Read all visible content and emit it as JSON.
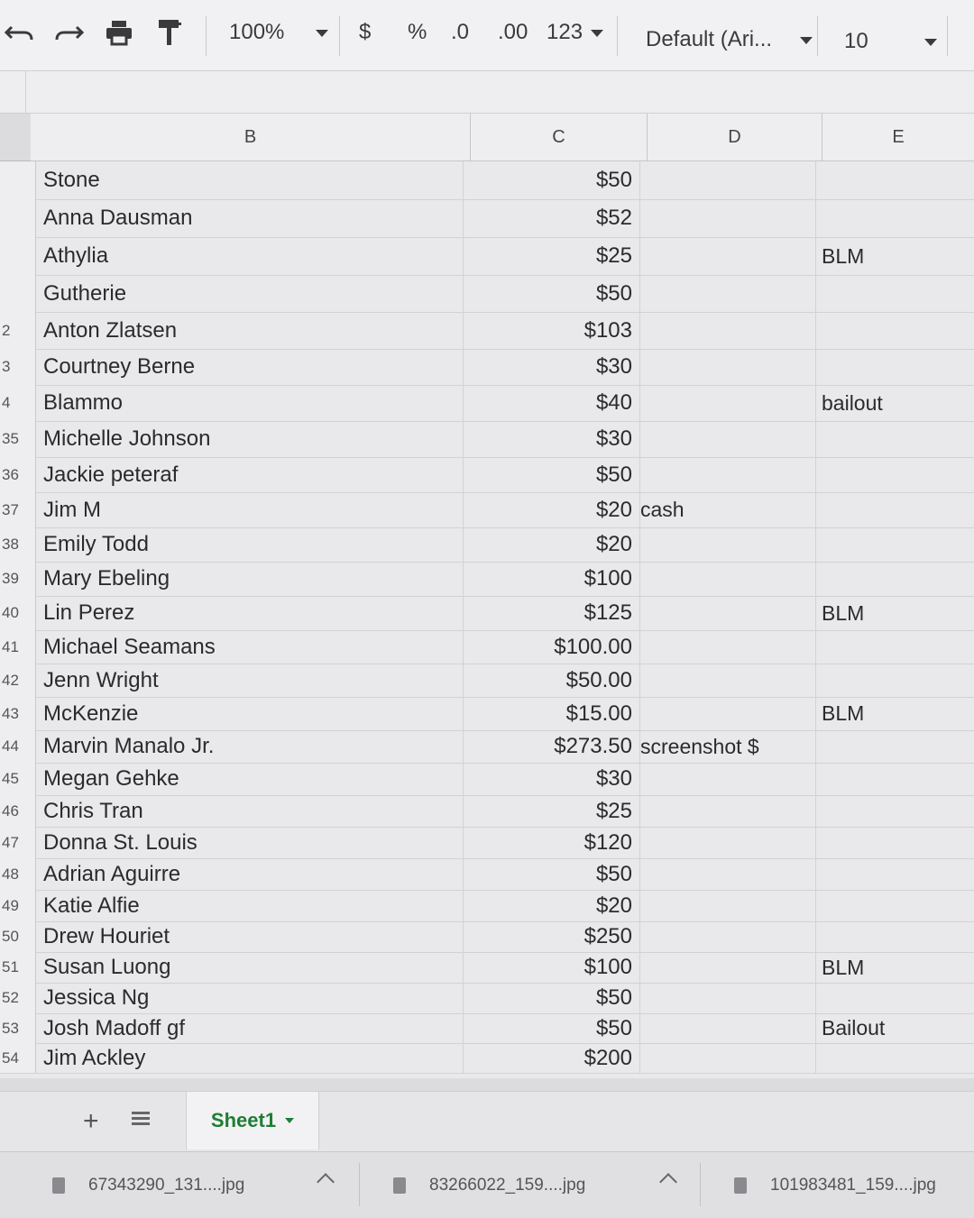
{
  "toolbar": {
    "zoom": "100%",
    "currency": "$",
    "percent": "%",
    "decrease_decimal": ".0",
    "increase_decimal": ".00",
    "more_formats": "123",
    "font": "Default (Ari...",
    "font_size": "10"
  },
  "columns": [
    "B",
    "C",
    "D",
    "E"
  ],
  "rows": [
    {
      "num": "",
      "name": "Stone",
      "amount": "$50",
      "note_d": "",
      "note_e": ""
    },
    {
      "num": "",
      "name": "Anna Dausman",
      "amount": "$52",
      "note_d": "",
      "note_e": ""
    },
    {
      "num": "",
      "name": "Athylia",
      "amount": "$25",
      "note_d": "",
      "note_e": "BLM"
    },
    {
      "num": "",
      "name": "Gutherie",
      "amount": "$50",
      "note_d": "",
      "note_e": ""
    },
    {
      "num": "2",
      "name": "Anton Zlatsen",
      "amount": "$103",
      "note_d": "",
      "note_e": ""
    },
    {
      "num": "3",
      "name": "Courtney Berne",
      "amount": "$30",
      "note_d": "",
      "note_e": ""
    },
    {
      "num": "4",
      "name": "Blammo",
      "amount": "$40",
      "note_d": "",
      "note_e": "bailout"
    },
    {
      "num": "35",
      "name": "Michelle Johnson",
      "amount": "$30",
      "note_d": "",
      "note_e": ""
    },
    {
      "num": "36",
      "name": "Jackie peteraf",
      "amount": "$50",
      "note_d": "",
      "note_e": ""
    },
    {
      "num": "37",
      "name": "Jim M",
      "amount": "$20",
      "note_d": "cash",
      "note_e": ""
    },
    {
      "num": "38",
      "name": "Emily Todd",
      "amount": "$20",
      "note_d": "",
      "note_e": ""
    },
    {
      "num": "39",
      "name": "Mary Ebeling",
      "amount": "$100",
      "note_d": "",
      "note_e": ""
    },
    {
      "num": "40",
      "name": "Lin Perez",
      "amount": "$125",
      "note_d": "",
      "note_e": "BLM"
    },
    {
      "num": "41",
      "name": "Michael Seamans",
      "amount": "$100.00",
      "note_d": "",
      "note_e": ""
    },
    {
      "num": "42",
      "name": "Jenn Wright",
      "amount": "$50.00",
      "note_d": "",
      "note_e": ""
    },
    {
      "num": "43",
      "name": "McKenzie",
      "amount": "$15.00",
      "note_d": "",
      "note_e": "BLM"
    },
    {
      "num": "44",
      "name": "Marvin Manalo Jr.",
      "amount": "$273.50",
      "note_d": "screenshot $",
      "note_e": ""
    },
    {
      "num": "45",
      "name": "Megan Gehke",
      "amount": "$30",
      "note_d": "",
      "note_e": ""
    },
    {
      "num": "46",
      "name": "Chris Tran",
      "amount": "$25",
      "note_d": "",
      "note_e": ""
    },
    {
      "num": "47",
      "name": "Donna St. Louis",
      "amount": "$120",
      "note_d": "",
      "note_e": ""
    },
    {
      "num": "48",
      "name": "Adrian Aguirre",
      "amount": "$50",
      "note_d": "",
      "note_e": ""
    },
    {
      "num": "49",
      "name": "Katie Alfie",
      "amount": "$20",
      "note_d": "",
      "note_e": ""
    },
    {
      "num": "50",
      "name": "Drew Houriet",
      "amount": "$250",
      "note_d": "",
      "note_e": ""
    },
    {
      "num": "51",
      "name": "Susan Luong",
      "amount": "$100",
      "note_d": "",
      "note_e": "BLM"
    },
    {
      "num": "52",
      "name": "Jessica Ng",
      "amount": "$50",
      "note_d": "",
      "note_e": ""
    },
    {
      "num": "53",
      "name": "Josh Madoff gf",
      "amount": "$50",
      "note_d": "",
      "note_e": "Bailout"
    },
    {
      "num": "54",
      "name": "Jim Ackley",
      "amount": "$200",
      "note_d": "",
      "note_e": ""
    }
  ],
  "sheet_tabs": [
    "Sheet1"
  ],
  "downloads": [
    {
      "file": "67343290_131....jpg"
    },
    {
      "file": "83266022_159....jpg"
    },
    {
      "file": "101983481_159....jpg"
    }
  ],
  "colors": {
    "sheet_tab_text": "#1e7e34",
    "grid_line": "#d2d2d5",
    "header_bg": "#eeedef"
  }
}
